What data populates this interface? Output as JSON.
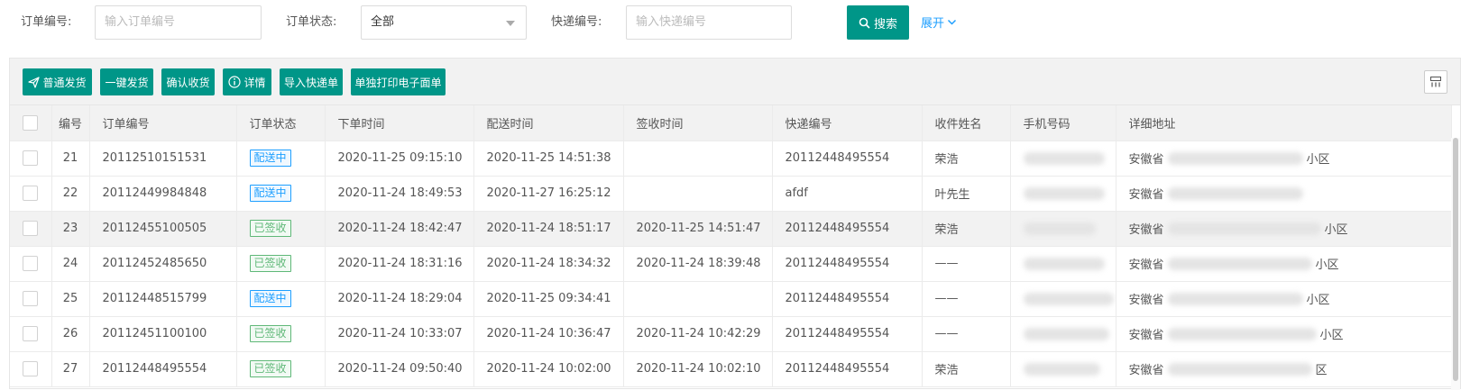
{
  "search": {
    "order_no_label": "订单编号:",
    "order_no_placeholder": "输入订单编号",
    "status_label": "订单状态:",
    "status_value": "全部",
    "express_label": "快递编号:",
    "express_placeholder": "输入快递编号",
    "search_button": "搜索",
    "expand_link": "展开"
  },
  "toolbar": {
    "normal_ship": "普通发货",
    "one_click_ship": "一键发货",
    "confirm_receipt": "确认收货",
    "details": "详情",
    "import_express": "导入快递单",
    "print_waybill": "单独打印电子面单"
  },
  "table": {
    "headers": [
      "编号",
      "订单编号",
      "订单状态",
      "下单时间",
      "配送时间",
      "签收时间",
      "快递编号",
      "收件姓名",
      "手机号码",
      "详细地址"
    ],
    "rows": [
      {
        "id": "21",
        "order_no": "20112510151531",
        "status": "配送中",
        "order_time": "2020-11-25 09:15:10",
        "delivery_time": "2020-11-25 14:51:38",
        "sign_time": "",
        "express_no": "20112448495554",
        "name": "荣浩",
        "address_prefix": "安徽省",
        "address_suffix": "小区"
      },
      {
        "id": "22",
        "order_no": "20112449984848",
        "status": "配送中",
        "order_time": "2020-11-24 18:49:53",
        "delivery_time": "2020-11-27 16:25:12",
        "sign_time": "",
        "express_no": "afdf",
        "name": "叶先生",
        "address_prefix": "安徽省",
        "address_suffix": ""
      },
      {
        "id": "23",
        "order_no": "20112455100505",
        "status": "已签收",
        "order_time": "2020-11-24 18:42:47",
        "delivery_time": "2020-11-24 18:51:17",
        "sign_time": "2020-11-25 14:51:47",
        "express_no": "20112448495554",
        "name": "荣浩",
        "address_prefix": "安徽省",
        "address_suffix": "小区"
      },
      {
        "id": "24",
        "order_no": "20112452485650",
        "status": "已签收",
        "order_time": "2020-11-24 18:31:16",
        "delivery_time": "2020-11-24 18:34:32",
        "sign_time": "2020-11-24 18:39:48",
        "express_no": "20112448495554",
        "name": "——",
        "address_prefix": "安徽省",
        "address_suffix": "小区"
      },
      {
        "id": "25",
        "order_no": "20112448515799",
        "status": "配送中",
        "order_time": "2020-11-24 18:29:04",
        "delivery_time": "2020-11-25 09:34:41",
        "sign_time": "",
        "express_no": "20112448495554",
        "name": "——",
        "address_prefix": "安徽省",
        "address_suffix": "小区"
      },
      {
        "id": "26",
        "order_no": "20112451100100",
        "status": "已签收",
        "order_time": "2020-11-24 10:33:07",
        "delivery_time": "2020-11-24 10:36:47",
        "sign_time": "2020-11-24 10:42:29",
        "express_no": "20112448495554",
        "name": "——",
        "address_prefix": "安徽省",
        "address_suffix": "小区"
      },
      {
        "id": "27",
        "order_no": "20112448495554",
        "status": "已签收",
        "order_time": "2020-11-24 09:50:40",
        "delivery_time": "2020-11-24 10:02:00",
        "sign_time": "2020-11-24 10:02:10",
        "express_no": "20112448495554",
        "name": "荣浩",
        "address_prefix": "安徽省",
        "address_suffix": "区"
      }
    ]
  },
  "colors": {
    "primary": "#009688",
    "link": "#1e9fff",
    "status_delivering": "#1e9fff",
    "status_signed": "#5fb878"
  },
  "icons": {
    "search_button": "search-icon",
    "expand": "chevron-down-icon",
    "normal_ship": "paper-plane-icon",
    "details": "info-circle-icon",
    "columns": "columns-grid-icon"
  }
}
